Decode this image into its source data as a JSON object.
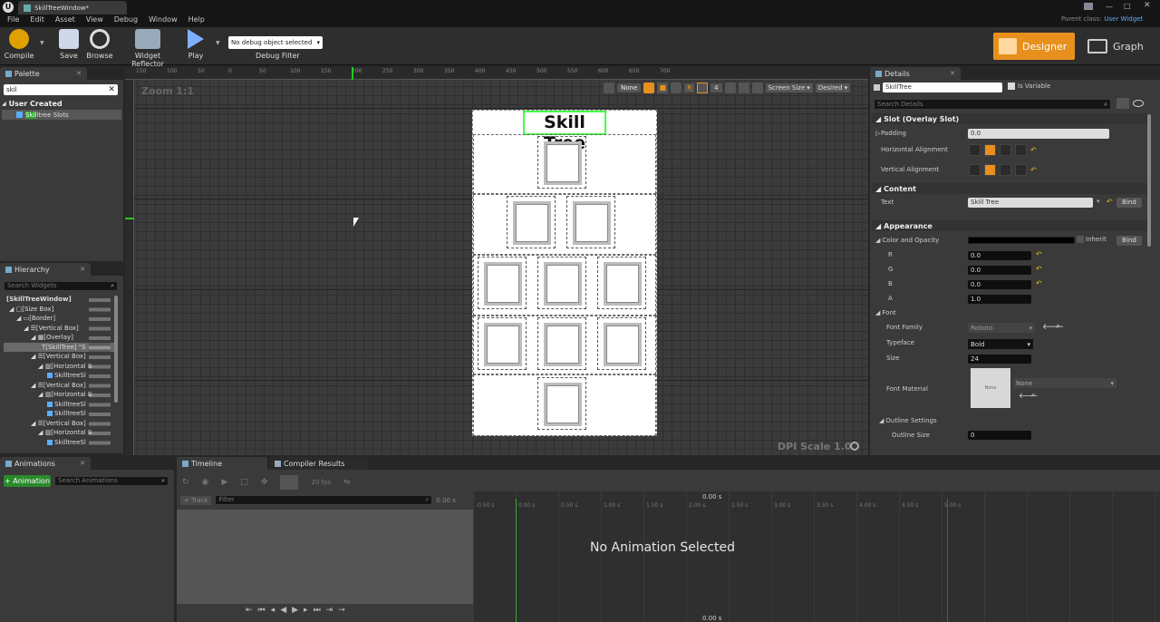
{
  "window": {
    "tab_title": "SkillTreeWindow*",
    "parent_class_label": "Parent class:",
    "parent_class_value": "User Widget"
  },
  "menu": [
    "File",
    "Edit",
    "Asset",
    "View",
    "Debug",
    "Window",
    "Help"
  ],
  "toolbar": {
    "compile": "Compile",
    "save": "Save",
    "browse": "Browse",
    "widget_reflector": "Widget Reflector",
    "play": "Play",
    "debug_select": "No debug object selected",
    "debug_filter": "Debug Filter",
    "designer": "Designer",
    "graph": "Graph"
  },
  "palette": {
    "title": "Palette",
    "search": "skil",
    "category": "User Created",
    "item_highlight": "Skil",
    "item_rest": "ltree Slots"
  },
  "hierarchy": {
    "title": "Hierarchy",
    "search_placeholder": "Search Widgets",
    "items": [
      "[SkillTreeWindow]",
      "[Size Box]",
      "[Border]",
      "[Vertical Box]",
      "[Overlay]",
      "[SkillTree] \"S",
      "[Vertical Box]",
      "[Horizontal B",
      "SkilltreeSl",
      "[Vertical Box]",
      "[Horizontal B",
      "SkilltreeSl",
      "SkilltreeSl",
      "[Vertical Box]",
      "[Horizontal B",
      "SkilltreeSl"
    ]
  },
  "designer": {
    "zoom": "Zoom 1:1",
    "dpi": "DPI Scale 1.0",
    "none_btn": "None",
    "r_btn": "R",
    "grid_val": "4",
    "screen_size": "Screen Size",
    "desired": "Desired",
    "ruler_top": [
      "150",
      "100",
      "50",
      "0",
      "50",
      "100",
      "150",
      "200",
      "250",
      "300",
      "350",
      "400",
      "450",
      "500",
      "550",
      "600",
      "650",
      "700"
    ],
    "preview_title": "Skill Tree"
  },
  "details": {
    "title": "Details",
    "name_value": "SkillTree",
    "is_variable": "Is Variable",
    "search_placeholder": "Search Details",
    "slot_section": "Slot (Overlay Slot)",
    "padding_label": "Padding",
    "padding_value": "0.0",
    "halign_label": "Horizontal Alignment",
    "valign_label": "Vertical Alignment",
    "content_section": "Content",
    "text_label": "Text",
    "text_value": "Skill Tree",
    "bind": "Bind",
    "appearance_section": "Appearance",
    "color_label": "Color and Opacity",
    "inherit": "Inherit",
    "r_label": "R",
    "r_value": "0.0",
    "g_label": "G",
    "g_value": "0.0",
    "b_label": "B",
    "b_value": "0.0",
    "a_label": "A",
    "a_value": "1.0",
    "font_label": "Font",
    "font_family_label": "Font Family",
    "font_family_value": "Roboto",
    "typeface_label": "Typeface",
    "typeface_value": "Bold",
    "size_label": "Size",
    "size_value": "24",
    "font_material_label": "Font Material",
    "font_material_value": "None",
    "material_thumb": "None",
    "outline_label": "Outline Settings",
    "outline_size_label": "Outline Size",
    "outline_size_value": "0"
  },
  "animations": {
    "title": "Animations",
    "add_btn": "+ Animation",
    "search_placeholder": "Search Animations"
  },
  "timeline": {
    "tab_timeline": "Timeline",
    "tab_compiler": "Compiler Results",
    "fps": "20 fps",
    "track": "+ Track",
    "filter_placeholder": "Filter",
    "time_left": "0.00 s",
    "time_top": "0.00 s",
    "time_bottom": "0.00 s",
    "empty": "No Animation Selected",
    "ticks": [
      "-0.50 s",
      "0.00 s",
      "0.50 s",
      "1.00 s",
      "1.50 s",
      "2.00 s",
      "2.50 s",
      "3.00 s",
      "3.50 s",
      "4.00 s",
      "4.50 s",
      "5.00 s"
    ]
  },
  "colors": {
    "accent": "#e8901d",
    "selection": "#44ff44",
    "preview_bg": "#ffffff"
  }
}
